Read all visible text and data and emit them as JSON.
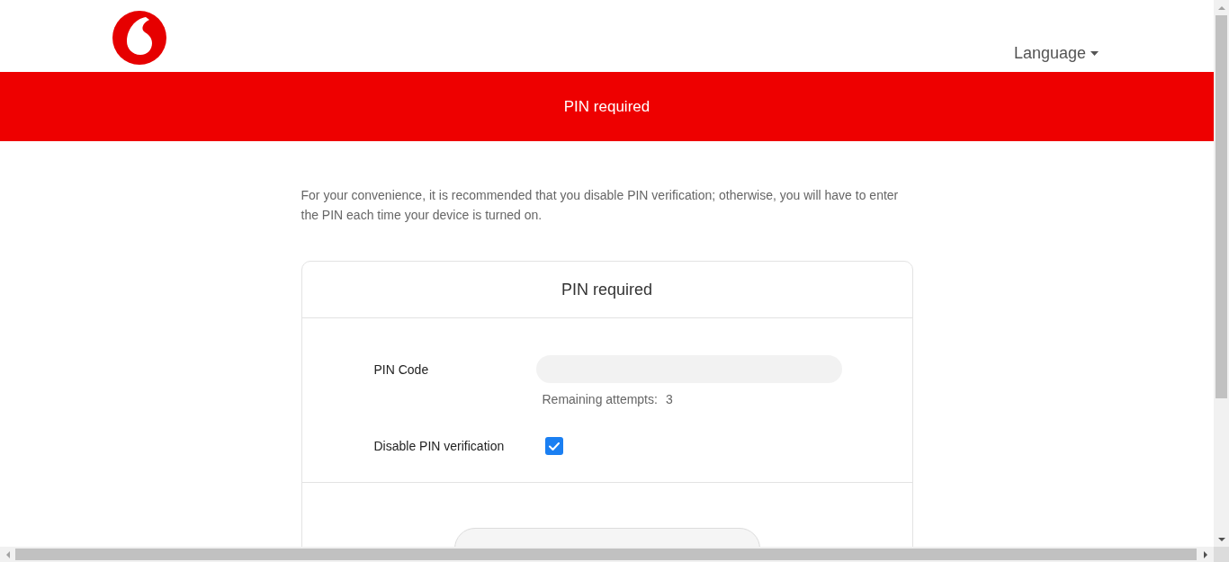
{
  "header": {
    "language_menu": {
      "label": "Language"
    }
  },
  "banner": {
    "title": "PIN required"
  },
  "notice": "For your convenience, it is recommended that you disable PIN verification; otherwise, you will have to enter the PIN each time your device is turned on.",
  "card": {
    "title": "PIN required",
    "fields": [
      {
        "kind": "input",
        "label": "PIN Code",
        "hint": {
          "label": "Remaining attempts:",
          "value": "3"
        }
      },
      {
        "kind": "checkbox",
        "label": "Disable PIN verification",
        "checked": true
      }
    ]
  }
}
